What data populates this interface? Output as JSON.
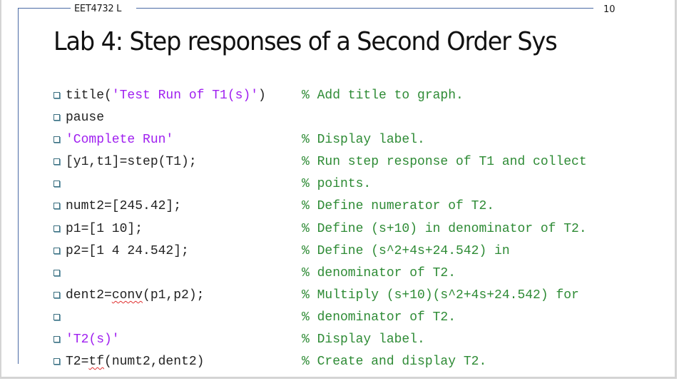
{
  "header": {
    "course": "EET4732 L",
    "page_number": "10"
  },
  "slide": {
    "title": "Lab 4: Step responses of a Second Order Sys"
  },
  "colors": {
    "frame_line": "#4a6aa5",
    "code_text": "#222222",
    "string": "#a020f0",
    "comment": "#2e8b35",
    "bullet": "#3b6f80",
    "spellcheck": "#e03030"
  },
  "lines": [
    {
      "pre": "title(",
      "str": "'Test Run of T1(s)'",
      "post": ")",
      "comment": "% Add title to graph."
    },
    {
      "pre": "pause",
      "str": "",
      "post": "",
      "comment": ""
    },
    {
      "pre": "",
      "str": "'Complete Run'",
      "post": "",
      "comment": "% Display label."
    },
    {
      "pre": "[y1,t1]=step(T1);",
      "str": "",
      "post": "",
      "comment": "% Run step response of T1 and collect"
    },
    {
      "pre": "",
      "str": "",
      "post": "",
      "comment": "% points."
    },
    {
      "pre": "numt2=[245.42];",
      "str": "",
      "post": "",
      "comment": "% Define numerator of T2."
    },
    {
      "pre": "p1=[1 10];",
      "str": "",
      "post": "",
      "comment": "% Define (s+10) in denominator of T2."
    },
    {
      "pre": "p2=[1 4 24.542];",
      "str": "",
      "post": "",
      "comment": "% Define (s^2+4s+24.542) in"
    },
    {
      "pre": "",
      "str": "",
      "post": "",
      "comment": "% denominator of T2."
    },
    {
      "pre": "dent2=",
      "spell": "conv",
      "post": "(p1,p2);",
      "str": "",
      "comment": "% Multiply (s+10)(s^2+4s+24.542) for"
    },
    {
      "pre": "",
      "str": "",
      "post": "",
      "comment": "% denominator of T2."
    },
    {
      "pre": "",
      "str": "'T2(s)'",
      "post": "",
      "comment": "% Display label."
    },
    {
      "pre": "T2=",
      "spell": "tf",
      "post": "(numt2,dent2)",
      "str": "",
      "comment": "% Create and display T2."
    }
  ]
}
